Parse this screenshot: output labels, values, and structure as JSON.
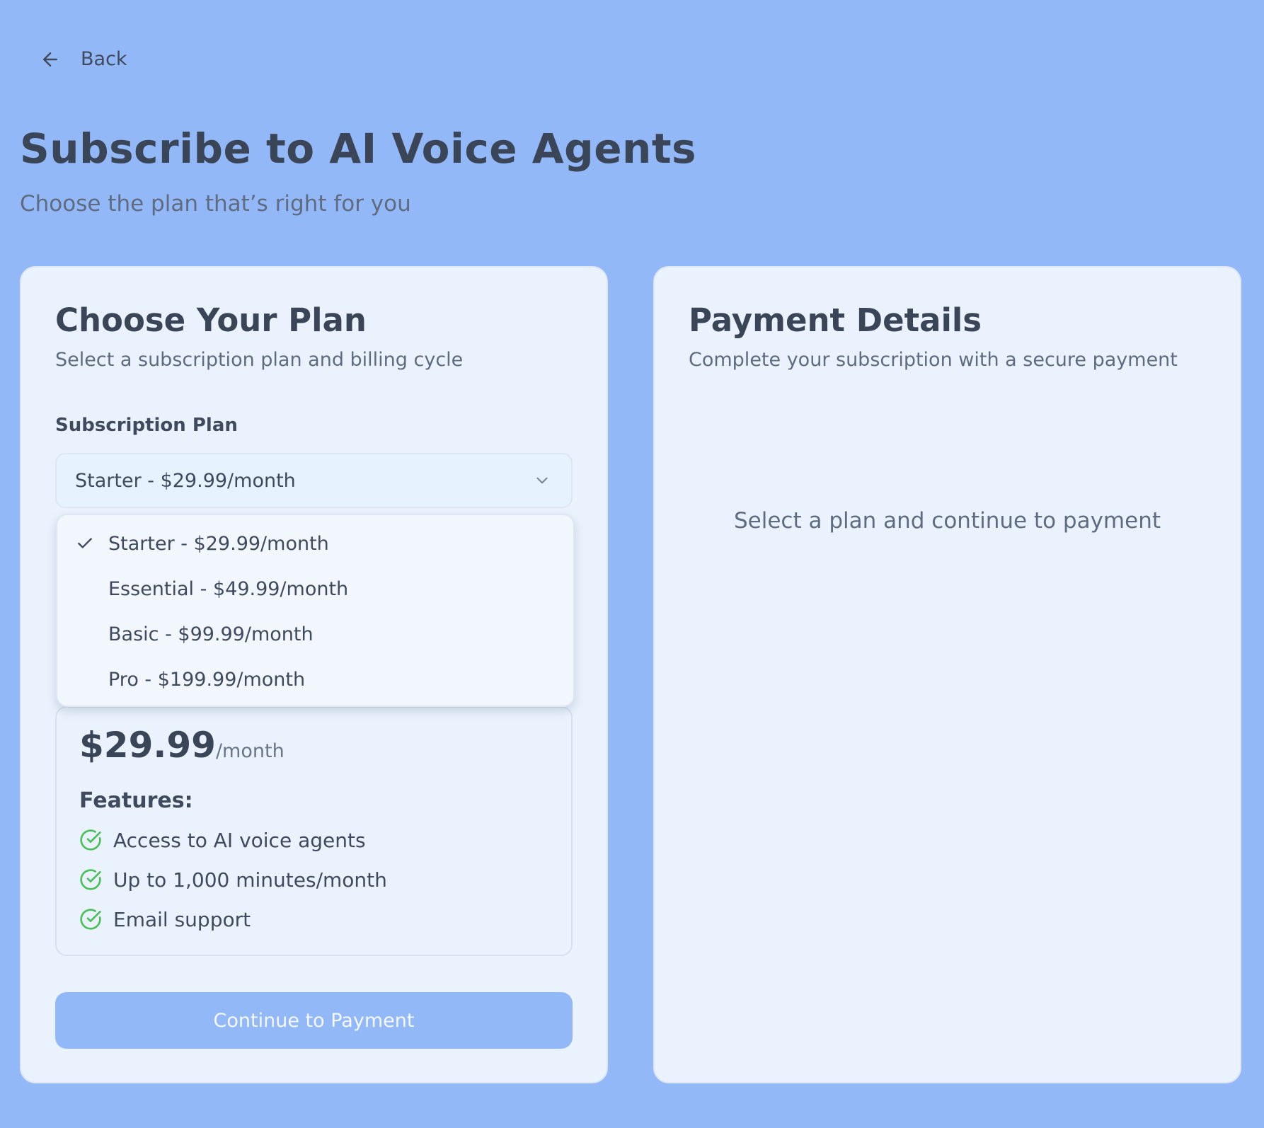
{
  "nav": {
    "back_label": "Back"
  },
  "header": {
    "title": "Subscribe to AI Voice Agents",
    "subtitle": "Choose the plan that’s right for you"
  },
  "plan_card": {
    "title": "Choose Your Plan",
    "subtitle": "Select a subscription plan and billing cycle",
    "field_label": "Subscription Plan",
    "selected_plan": "Starter - $29.99/month",
    "price": "$29.99",
    "price_period": "/month",
    "features_title": "Features:",
    "features": [
      "Access to AI voice agents",
      "Up to 1,000 minutes/month",
      "Email support"
    ],
    "continue_label": "Continue to Payment"
  },
  "dropdown": {
    "options": [
      {
        "label": "Starter - $29.99/month",
        "selected": true
      },
      {
        "label": "Essential - $49.99/month",
        "selected": false
      },
      {
        "label": "Basic - $99.99/month",
        "selected": false
      },
      {
        "label": "Pro - $199.99/month",
        "selected": false
      }
    ]
  },
  "payment_card": {
    "title": "Payment Details",
    "subtitle": "Complete your subscription with a secure payment",
    "empty_message": "Select a plan and continue to payment"
  },
  "colors": {
    "background": "#93b8f7",
    "card": "#eaf3fd",
    "text_primary": "#3b4558",
    "text_muted": "#5f6b80",
    "success": "#4cbf5c",
    "button": "#93b8f7"
  }
}
